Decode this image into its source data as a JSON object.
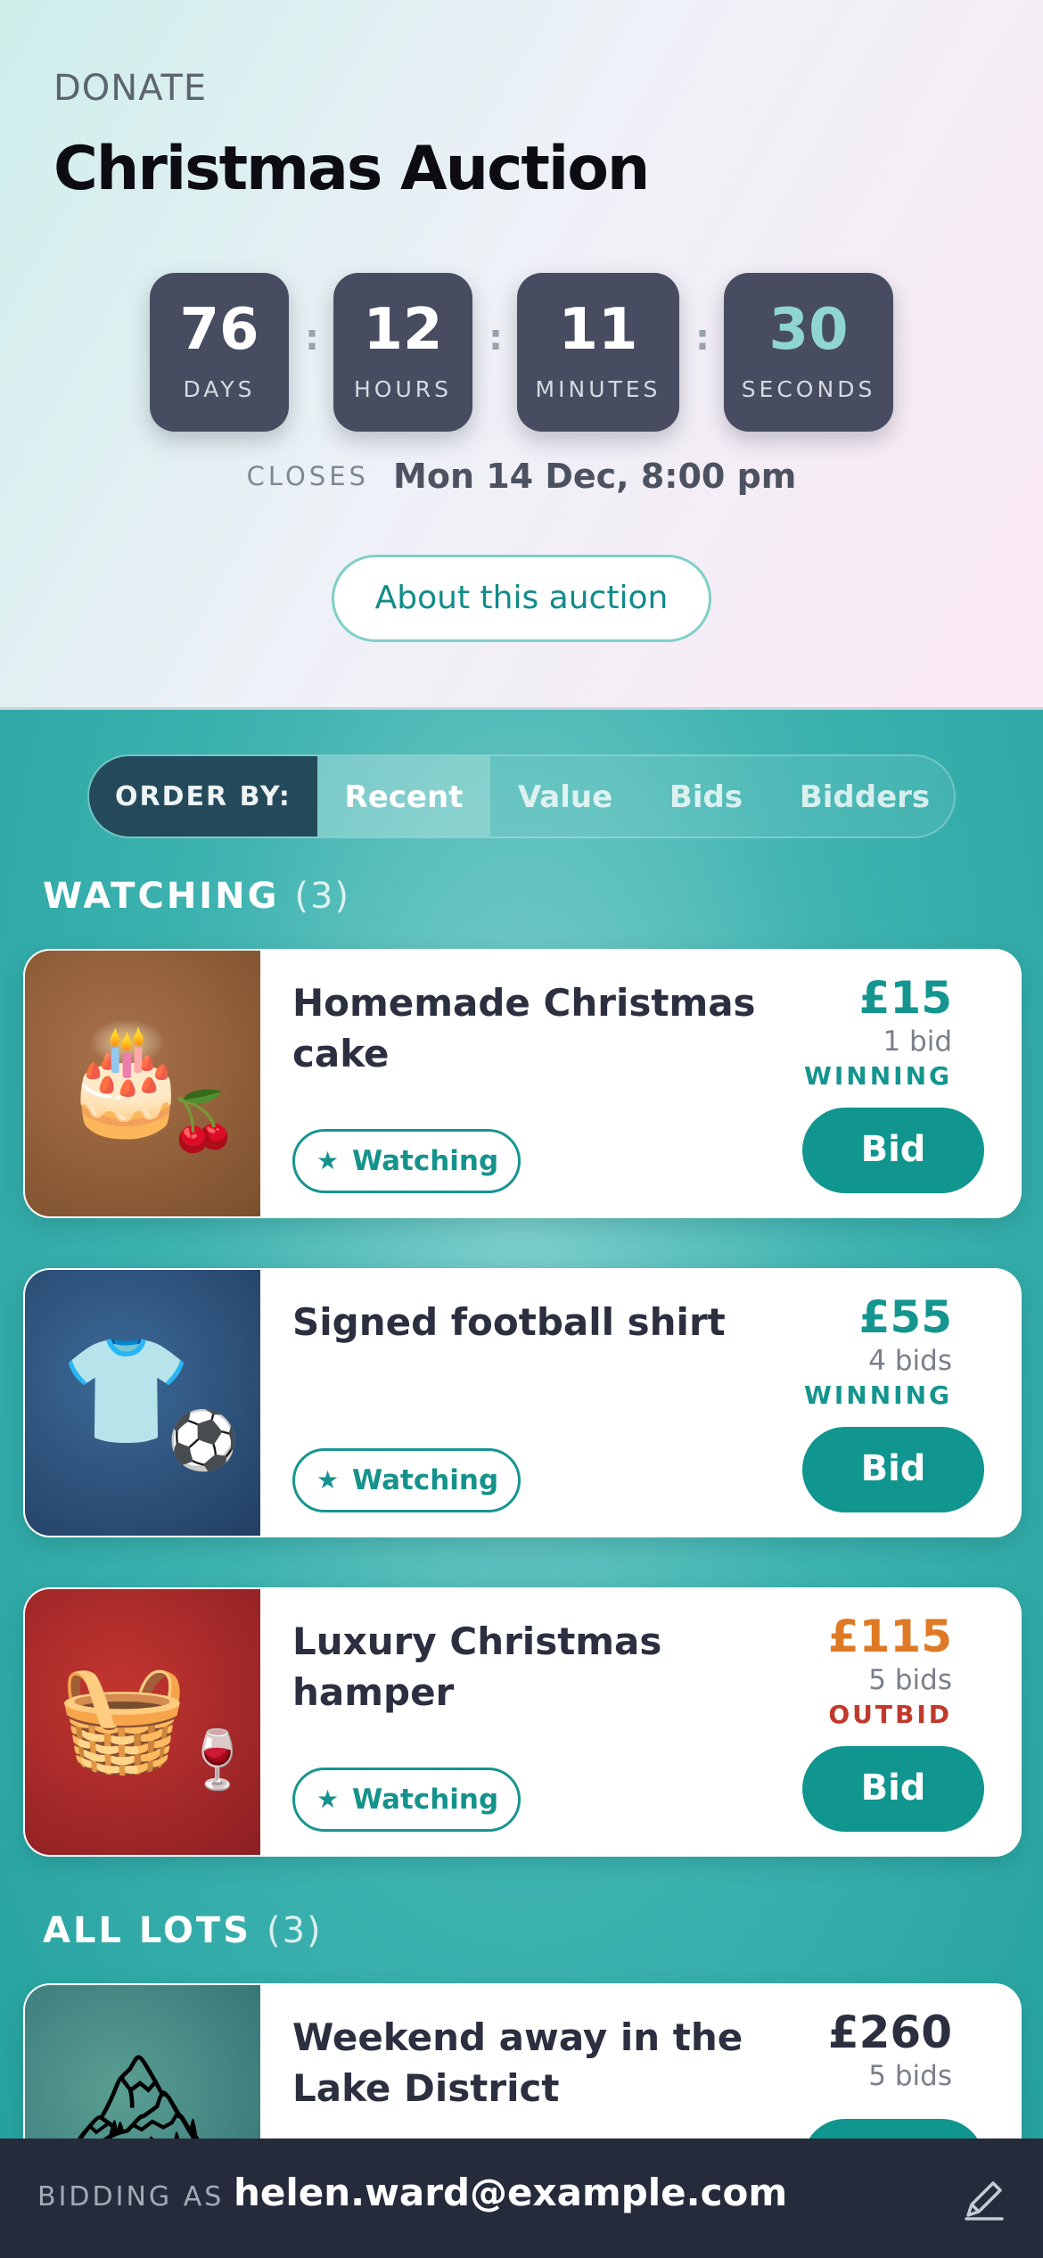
{
  "header": {
    "brand": "DONATE",
    "title": "Christmas Auction",
    "countdown": [
      {
        "value": "76",
        "unit": "DAYS"
      },
      {
        "value": "12",
        "unit": "HOURS"
      },
      {
        "value": "11",
        "unit": "MINUTES"
      },
      {
        "value": "30",
        "unit": "SECONDS"
      }
    ],
    "closes_label": "CLOSES",
    "closes_value": "Mon 14 Dec, 8:00 pm",
    "about_label": "About this auction"
  },
  "order_by": {
    "label": "ORDER BY:",
    "tabs": [
      "Recent",
      "Value",
      "Bids",
      "Bidders"
    ],
    "active": "Recent"
  },
  "watching": {
    "title": "WATCHING",
    "count": "(3)",
    "items": [
      {
        "name": "Homemade Christmas cake",
        "price": "£15",
        "bids": "1 bid",
        "status": "WINNING",
        "watch_label": "Watching",
        "bid_label": "Bid",
        "icon": "cake-icon",
        "icon_side": "cherries-icon"
      },
      {
        "name": "Signed football shirt",
        "price": "£55",
        "bids": "4 bids",
        "status": "WINNING",
        "watch_label": "Watching",
        "bid_label": "Bid",
        "icon": "shirt-icon",
        "icon_side": "football-icon"
      },
      {
        "name": "Luxury Christmas hamper",
        "price": "£115",
        "bids": "5 bids",
        "status": "OUTBID",
        "watch_label": "Watching",
        "bid_label": "Bid",
        "icon": "basket-icon",
        "icon_side": "wine-glass-icon"
      }
    ]
  },
  "all_lots": {
    "title": "ALL LOTS",
    "count": "(3)",
    "items": [
      {
        "name": "Weekend away in the Lake District",
        "price": "£260",
        "bids": "5 bids",
        "icon": "mountain-icon"
      }
    ]
  },
  "footer": {
    "label": "BIDDING AS",
    "email": "helen.ward@example.com"
  },
  "colors": {
    "accent": "#10958f",
    "outbid_price": "#de7a25",
    "outbid_status": "#c0392b",
    "footer_bg": "#262b3c"
  }
}
